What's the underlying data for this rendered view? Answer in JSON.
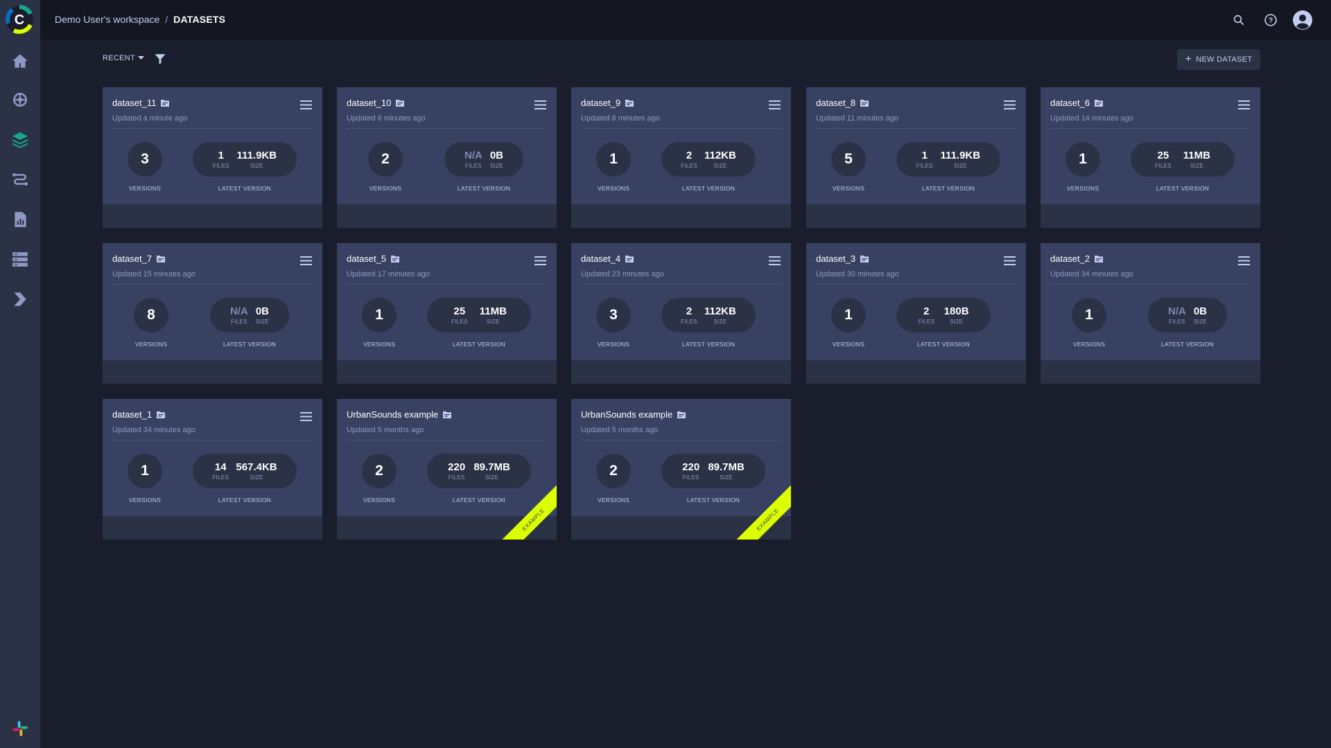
{
  "header": {
    "workspace": "Demo User's workspace",
    "separator": "/",
    "current": "DATASETS"
  },
  "sidebar": {
    "items": [
      {
        "name": "home-icon"
      },
      {
        "name": "brain-icon"
      },
      {
        "name": "layers-icon"
      },
      {
        "name": "pipelines-icon"
      },
      {
        "name": "reports-icon"
      },
      {
        "name": "orchestration-icon"
      },
      {
        "name": "deploy-icon"
      }
    ],
    "bottom_icon": "slack-icon"
  },
  "toolbar": {
    "sort_label": "RECENT",
    "new_button": "NEW DATASET"
  },
  "labels": {
    "versions": "VERSIONS",
    "files": "FILES",
    "size": "SIZE",
    "latest_version": "LATEST VERSION",
    "example": "EXAMPLE"
  },
  "colors": {
    "accent_example": "#dbff00",
    "card_bg": "#384161",
    "page_bg": "#1a1e2c"
  },
  "datasets": [
    {
      "name": "dataset_11",
      "updated": "Updated a minute ago",
      "versions": "3",
      "files": "1",
      "size": "111.9KB",
      "example": false
    },
    {
      "name": "dataset_10",
      "updated": "Updated 6 minutes ago",
      "versions": "2",
      "files": "N/A",
      "size": "0B",
      "example": false
    },
    {
      "name": "dataset_9",
      "updated": "Updated 8 minutes ago",
      "versions": "1",
      "files": "2",
      "size": "112KB",
      "example": false
    },
    {
      "name": "dataset_8",
      "updated": "Updated 11 minutes ago",
      "versions": "5",
      "files": "1",
      "size": "111.9KB",
      "example": false
    },
    {
      "name": "dataset_6",
      "updated": "Updated 14 minutes ago",
      "versions": "1",
      "files": "25",
      "size": "11MB",
      "example": false
    },
    {
      "name": "dataset_7",
      "updated": "Updated 15 minutes ago",
      "versions": "8",
      "files": "N/A",
      "size": "0B",
      "example": false
    },
    {
      "name": "dataset_5",
      "updated": "Updated 17 minutes ago",
      "versions": "1",
      "files": "25",
      "size": "11MB",
      "example": false
    },
    {
      "name": "dataset_4",
      "updated": "Updated 23 minutes ago",
      "versions": "3",
      "files": "2",
      "size": "112KB",
      "example": false
    },
    {
      "name": "dataset_3",
      "updated": "Updated 30 minutes ago",
      "versions": "1",
      "files": "2",
      "size": "180B",
      "example": false
    },
    {
      "name": "dataset_2",
      "updated": "Updated 34 minutes ago",
      "versions": "1",
      "files": "N/A",
      "size": "0B",
      "example": false
    },
    {
      "name": "dataset_1",
      "updated": "Updated 34 minutes ago",
      "versions": "1",
      "files": "14",
      "size": "567.4KB",
      "example": false
    },
    {
      "name": "UrbanSounds example",
      "updated": "Updated 5 months ago",
      "versions": "2",
      "files": "220",
      "size": "89.7MB",
      "example": true
    },
    {
      "name": "UrbanSounds example",
      "updated": "Updated 5 months ago",
      "versions": "2",
      "files": "220",
      "size": "89.7MB",
      "example": true
    }
  ]
}
